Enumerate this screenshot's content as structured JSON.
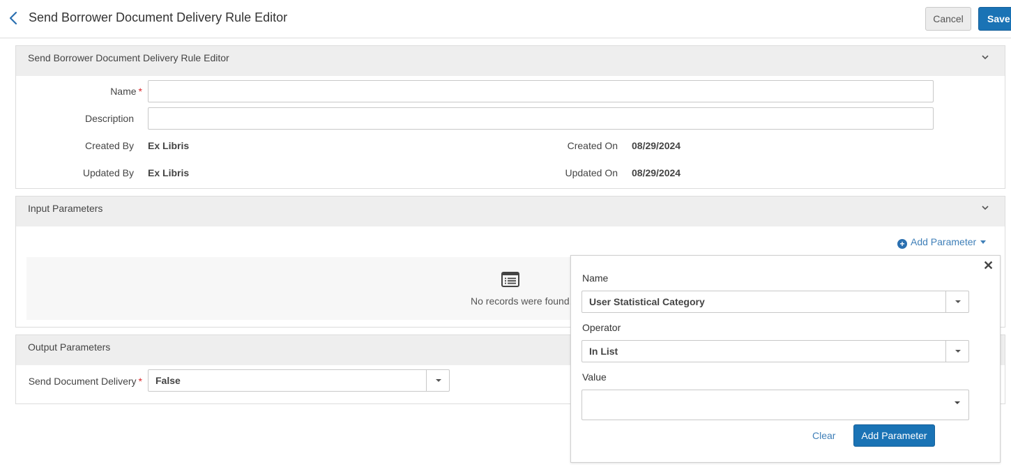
{
  "header": {
    "title": "Send Borrower Document Delivery Rule Editor",
    "cancel_label": "Cancel",
    "save_label": "Save"
  },
  "general_section": {
    "title": "Send Borrower Document Delivery Rule Editor",
    "name_label": "Name",
    "name_value": "",
    "description_label": "Description",
    "description_value": "",
    "created_by_label": "Created By",
    "created_by_value": "Ex Libris",
    "updated_by_label": "Updated By",
    "updated_by_value": "Ex Libris",
    "created_on_label": "Created On",
    "created_on_value": "08/29/2024",
    "updated_on_label": "Updated On",
    "updated_on_value": "08/29/2024"
  },
  "input_section": {
    "title": "Input Parameters",
    "add_parameter_label": "Add Parameter",
    "empty_message": "No records were found."
  },
  "output_section": {
    "title": "Output Parameters",
    "send_dd_label": "Send Document Delivery",
    "send_dd_value": "False"
  },
  "popup": {
    "name_label": "Name",
    "name_value": "User Statistical Category",
    "operator_label": "Operator",
    "operator_value": "In List",
    "value_label": "Value",
    "value_value": "",
    "clear_label": "Clear",
    "add_label": "Add Parameter"
  },
  "required_marker": "*",
  "colors": {
    "primary": "#1a73b5",
    "link": "#3f7fb8",
    "required": "#d9262a",
    "section_header_bg": "#eeeeee"
  }
}
